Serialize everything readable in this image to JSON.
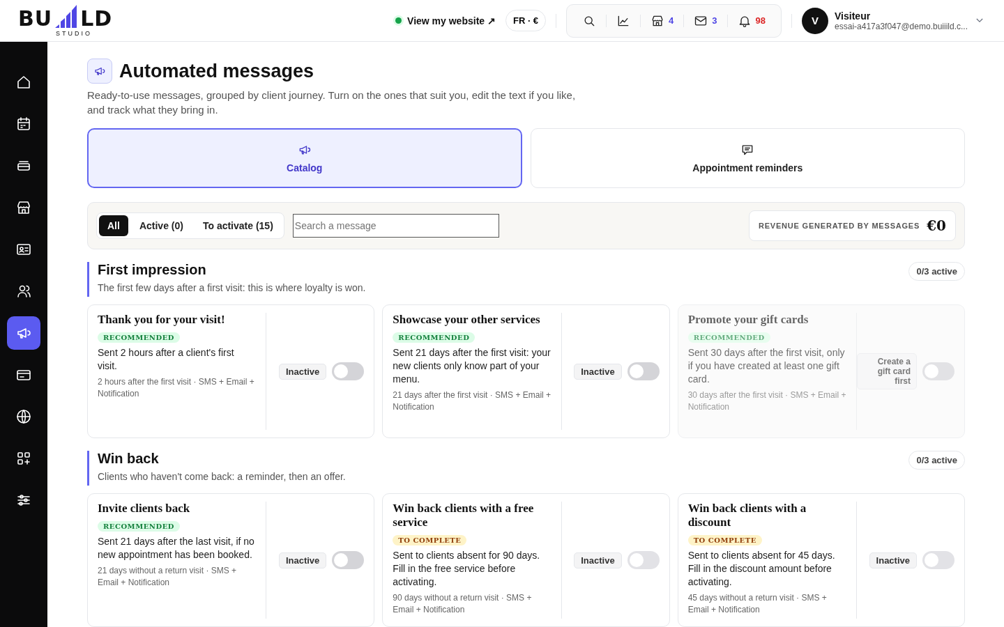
{
  "header": {
    "logo": {
      "left": "BU",
      "right": "LD",
      "sub": "STUDIO"
    },
    "website_link": "View my website ↗",
    "locale": "FR · €",
    "counters": [
      {
        "count": "4",
        "color": "#4f46e5"
      },
      {
        "count": "3",
        "color": "#4f46e5"
      },
      {
        "count": "98",
        "color": "#dc2626"
      }
    ],
    "user": {
      "initial": "V",
      "name": "Visiteur",
      "email": "essai-a417a3f047@demo.buiiild.c..."
    }
  },
  "sidebar": {
    "items": [
      {
        "selected": false
      },
      {
        "selected": false
      },
      {
        "selected": false
      },
      {
        "selected": false
      },
      {
        "selected": false
      },
      {
        "selected": false
      },
      {
        "selected": true
      },
      {
        "selected": false
      },
      {
        "selected": false
      },
      {
        "selected": false
      },
      {
        "selected": false
      }
    ]
  },
  "page": {
    "title": "Automated messages",
    "description": "Ready-to-use messages, grouped by client journey. Turn on the ones that suit you, edit the text if you like, and track what they bring in."
  },
  "views": [
    {
      "label": "Catalog",
      "selected": true
    },
    {
      "label": "Appointment reminders",
      "selected": false
    }
  ],
  "filters": {
    "tabs": [
      {
        "label": "All",
        "selected": true
      },
      {
        "label": "Active (0)",
        "selected": false
      },
      {
        "label": "To activate (15)",
        "selected": false
      }
    ],
    "search": {
      "placeholder": "Search a message"
    },
    "revenue": {
      "label": "REVENUE GENERATED BY MESSAGES",
      "value": "€0"
    }
  },
  "sections": [
    {
      "title": "First impression",
      "subtitle": "The first few days after a first visit: this is where loyalty is won.",
      "count": "0/3 active",
      "cards": [
        {
          "title": "Thank you for your visit!",
          "badge": {
            "kind": "recommended",
            "label": "RECOMMENDED"
          },
          "text": "Sent 2 hours after a client's first visit.",
          "meta": "2 hours after the first visit · SMS + Email + Notification",
          "status": {
            "kind": "state",
            "label": "Inactive"
          },
          "on": false,
          "disabled": false,
          "toggle_disabled": false
        },
        {
          "title": "Showcase your other services",
          "badge": {
            "kind": "recommended",
            "label": "RECOMMENDED"
          },
          "text": "Sent 21 days after the first visit: your new clients only know part of your menu.",
          "meta": "21 days after the first visit · SMS + Email + Notification",
          "status": {
            "kind": "state",
            "label": "Inactive"
          },
          "on": false,
          "disabled": false,
          "toggle_disabled": false
        },
        {
          "title": "Promote your gift cards",
          "badge": {
            "kind": "recommended",
            "label": "RECOMMENDED"
          },
          "text": "Sent 30 days after the first visit, only if you have created at least one gift card.",
          "meta": "30 days after the first visit · SMS + Email + Notification",
          "status": {
            "kind": "action",
            "label": "Create a gift card first"
          },
          "on": false,
          "disabled": true
        }
      ]
    },
    {
      "title": "Win back",
      "subtitle": "Clients who haven't come back: a reminder, then an offer.",
      "count": "0/3 active",
      "cards": [
        {
          "title": "Invite clients back",
          "badge": {
            "kind": "recommended",
            "label": "RECOMMENDED"
          },
          "text": "Sent 21 days after the last visit, if no new appointment has been booked.",
          "meta": "21 days without a return visit · SMS + Email + Notification",
          "status": {
            "kind": "state",
            "label": "Inactive"
          },
          "on": false,
          "disabled": false,
          "toggle_disabled": false
        },
        {
          "title": "Win back clients with a free service",
          "badge": {
            "kind": "complete",
            "label": "TO COMPLETE"
          },
          "text": "Sent to clients absent for 90 days. Fill in the free service before activating.",
          "meta": "90 days without a return visit · SMS + Email + Notification",
          "status": {
            "kind": "state",
            "label": "Inactive"
          },
          "on": false,
          "disabled": false,
          "toggle_disabled": true
        },
        {
          "title": "Win back clients with a discount",
          "badge": {
            "kind": "complete",
            "label": "TO COMPLETE"
          },
          "text": "Sent to clients absent for 45 days. Fill in the discount amount before activating.",
          "meta": "45 days without a return visit · SMS + Email + Notification",
          "status": {
            "kind": "state",
            "label": "Inactive"
          },
          "on": false,
          "disabled": false,
          "toggle_disabled": true
        }
      ]
    }
  ]
}
